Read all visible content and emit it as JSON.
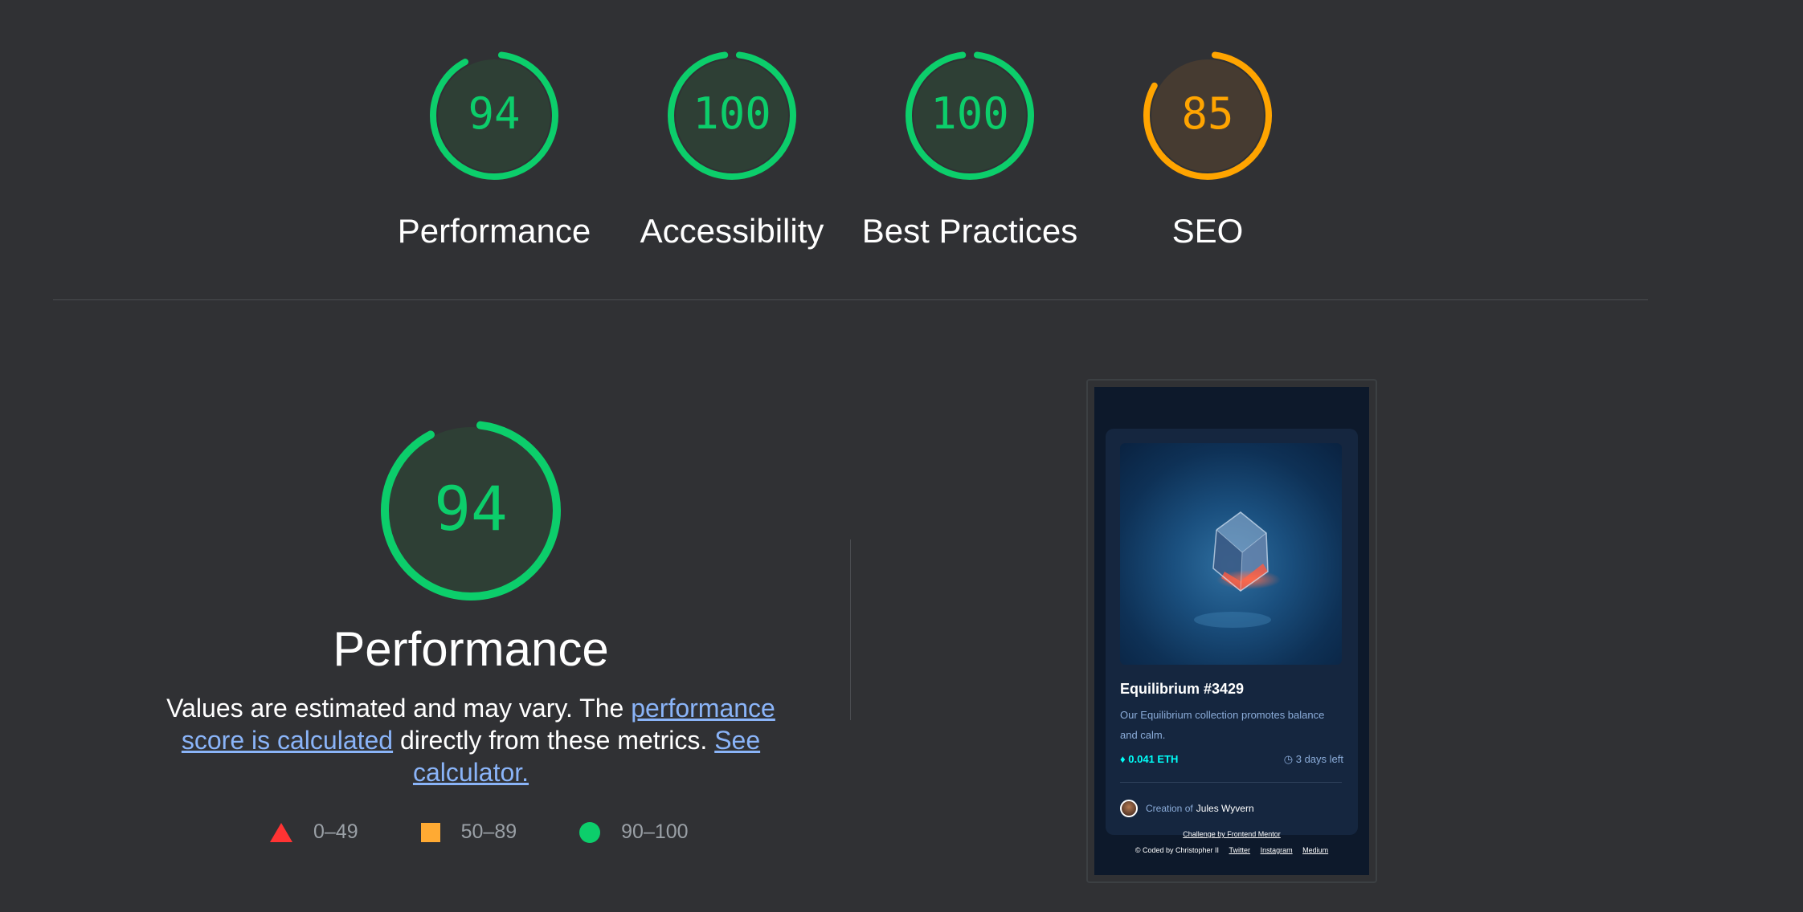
{
  "scores": [
    {
      "label": "Performance",
      "score": "94",
      "value": 94,
      "color": "#0cce6b",
      "fill": "#2e3f35"
    },
    {
      "label": "Accessibility",
      "score": "100",
      "value": 100,
      "color": "#0cce6b",
      "fill": "#2e3f35"
    },
    {
      "label": "Best Practices",
      "score": "100",
      "value": 100,
      "color": "#0cce6b",
      "fill": "#2e3f35"
    },
    {
      "label": "SEO",
      "score": "85",
      "value": 85,
      "color": "#ffa400",
      "fill": "#463b31"
    }
  ],
  "performance": {
    "score": "94",
    "value": 94,
    "title": "Performance",
    "desc_text_1": "Values are estimated and may vary. The ",
    "desc_link_1": "performance score is calculated",
    "desc_text_2": " directly from these metrics. ",
    "desc_link_2": "See calculator."
  },
  "legend": [
    {
      "shape": "triangle",
      "label": "0–49",
      "color": "#ff3333"
    },
    {
      "shape": "square",
      "label": "50–89",
      "color": "#ffaa33"
    },
    {
      "shape": "circle",
      "label": "90–100",
      "color": "#0cce6b"
    }
  ],
  "screenshot": {
    "card_title": "Equilibrium #3429",
    "card_desc": "Our Equilibrium collection promotes balance and calm.",
    "price": "0.041 ETH",
    "days_left": "3 days left",
    "creation_prefix": "Creation of",
    "creator_name": "Jules Wyvern",
    "challenge_text": "Challenge by Frontend Mentor",
    "coded_by": "© Coded by Christopher II",
    "links": [
      "Twitter",
      "Instagram",
      "Medium"
    ]
  },
  "icons": {
    "eth": "ethereum-icon",
    "clock": "clock-icon"
  }
}
